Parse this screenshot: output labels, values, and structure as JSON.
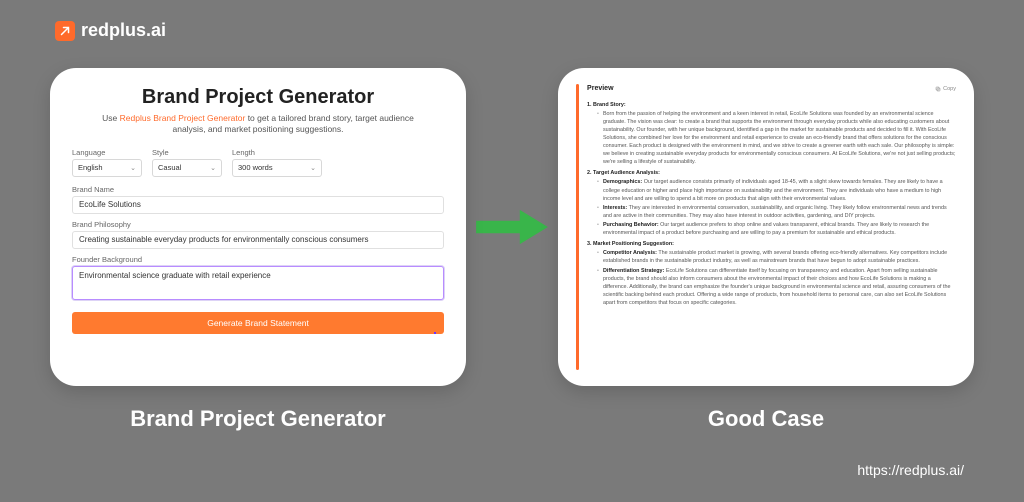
{
  "brand": {
    "name": "redplus.ai"
  },
  "footer": {
    "url": "https://redplus.ai/"
  },
  "captions": {
    "left": "Brand Project Generator",
    "right": "Good Case"
  },
  "form": {
    "title": "Brand Project Generator",
    "subtitle_pre": "Use ",
    "subtitle_hl": "Redplus Brand Project Generator",
    "subtitle_post": " to get a tailored brand story, target audience analysis, and market positioning suggestions.",
    "language": {
      "label": "Language",
      "value": "English"
    },
    "style": {
      "label": "Style",
      "value": "Casual"
    },
    "length": {
      "label": "Length",
      "value": "300 words"
    },
    "brand_name": {
      "label": "Brand Name",
      "value": "EcoLife Solutions"
    },
    "philosophy": {
      "label": "Brand Philosophy",
      "value": "Creating sustainable everyday products for environmentally conscious consumers"
    },
    "founder": {
      "label": "Founder Background",
      "value": "Environmental science graduate with retail experience"
    },
    "button": "Generate Brand Statement"
  },
  "preview": {
    "header": "Preview",
    "copy": "Copy",
    "sections": {
      "s1": {
        "num": "1.",
        "title": "Brand Story:",
        "body": "Born from the passion of helping the environment and a keen interest in retail, EcoLife Solutions was founded by an environmental science graduate. The vision was clear: to create a brand that supports the environment through everyday products while also educating customers about sustainability. Our founder, with her unique background, identified a gap in the market for sustainable products and decided to fill it. With EcoLife Solutions, she combined her love for the environment and retail experience to create an eco-friendly brand that offers solutions for the conscious consumer. Each product is designed with the environment in mind, and we strive to create a greener earth with each sale. Our philosophy is simple: we believe in creating sustainable everyday products for environmentally conscious consumers. At EcoLife Solutions, we're not just selling products; we're selling a lifestyle of sustainability."
      },
      "s2": {
        "num": "2.",
        "title": "Target Audience Analysis:",
        "demo_label": "Demographics:",
        "demo": "Our target audience consists primarily of individuals aged 18-45, with a slight skew towards females. They are likely to have a college education or higher and place high importance on sustainability and the environment. They are individuals who have a medium to high income level and are willing to spend a bit more on products that align with their environmental values.",
        "int_label": "Interests:",
        "int": "They are interested in environmental conservation, sustainability, and organic living. They likely follow environmental news and trends and are active in their communities. They may also have interest in outdoor activities, gardening, and DIY projects.",
        "beh_label": "Purchasing Behavior:",
        "beh": "Our target audience prefers to shop online and values transparent, ethical brands. They are likely to research the environmental impact of a product before purchasing and are willing to pay a premium for sustainable and ethical products."
      },
      "s3": {
        "num": "3.",
        "title": "Market Positioning Suggestion:",
        "comp_label": "Competitor Analysis:",
        "comp": "The sustainable product market is growing, with several brands offering eco-friendly alternatives. Key competitors include established brands in the sustainable product industry, as well as mainstream brands that have begun to adopt sustainable practices.",
        "diff_label": "Differentiation Strategy:",
        "diff": "EcoLife Solutions can differentiate itself by focusing on transparency and education. Apart from selling sustainable products, the brand should also inform consumers about the environmental impact of their choices and how EcoLife Solutions is making a difference. Additionally, the brand can emphasize the founder's unique background in environmental science and retail, assuring consumers of the scientific backing behind each product. Offering a wide range of products, from household items to personal care, can also set EcoLife Solutions apart from competitors that focus on specific categories."
      }
    }
  }
}
